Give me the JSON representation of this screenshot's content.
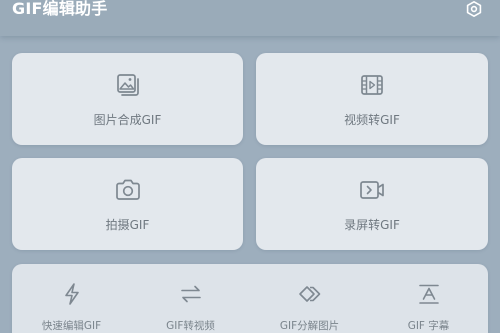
{
  "header": {
    "title": "GIF编辑助手",
    "settings_icon": "settings-hexagon-icon"
  },
  "cards": [
    {
      "label": "图片合成GIF",
      "icon": "image-stack-icon"
    },
    {
      "label": "视频转GIF",
      "icon": "film-strip-icon"
    },
    {
      "label": "拍摄GIF",
      "icon": "camera-icon"
    },
    {
      "label": "录屏转GIF",
      "icon": "screen-record-icon"
    }
  ],
  "tools": [
    {
      "label": "快速编辑GIF",
      "icon": "lightning-icon"
    },
    {
      "label": "GIF转视频",
      "icon": "swap-arrows-icon"
    },
    {
      "label": "GIF分解图片",
      "icon": "diamond-layers-icon"
    },
    {
      "label": "GIF 字幕",
      "icon": "text-caption-icon"
    }
  ],
  "colors": {
    "background": "#9daebd",
    "card": "#e3e8ed",
    "icon": "#7e8891",
    "label": "#6f7880"
  }
}
